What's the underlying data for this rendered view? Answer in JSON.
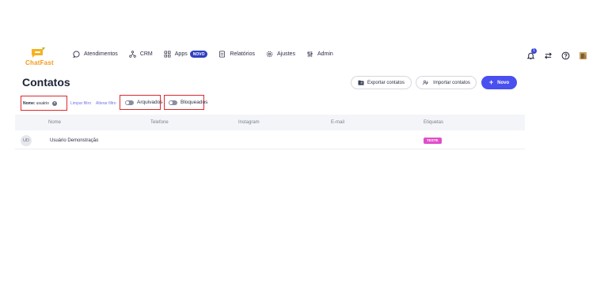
{
  "brand": {
    "name": "ChatFast"
  },
  "nav": {
    "items": [
      {
        "label": "Atendimentos"
      },
      {
        "label": "CRM"
      },
      {
        "label": "Apps",
        "badge": "NOVO"
      },
      {
        "label": "Relatórios"
      },
      {
        "label": "Ajustes"
      },
      {
        "label": "Admin"
      }
    ]
  },
  "notifications": {
    "count": "1"
  },
  "page": {
    "title": "Contatos"
  },
  "actions": {
    "export_label": "Exportar contatos",
    "import_label": "Importar contatos",
    "new_label": "Novo"
  },
  "filters": {
    "chip_key": "Nome:",
    "chip_value": "usuário",
    "clear_label": "Limpar filtro",
    "change_label": "Alterar filtro",
    "archived_label": "Arquivados",
    "blocked_label": "Bloqueados"
  },
  "table": {
    "columns": [
      "Nome",
      "Telefone",
      "Instagram",
      "E-mail",
      "Etiquetas"
    ],
    "rows": [
      {
        "initials": "UD",
        "name": "Usuário Demonstração",
        "tag": "TESTE"
      }
    ]
  },
  "colors": {
    "accent": "#4a4ff0",
    "highlight_box": "#e0272c",
    "tag": "#e04fc9",
    "brand": "#f29a1a"
  }
}
